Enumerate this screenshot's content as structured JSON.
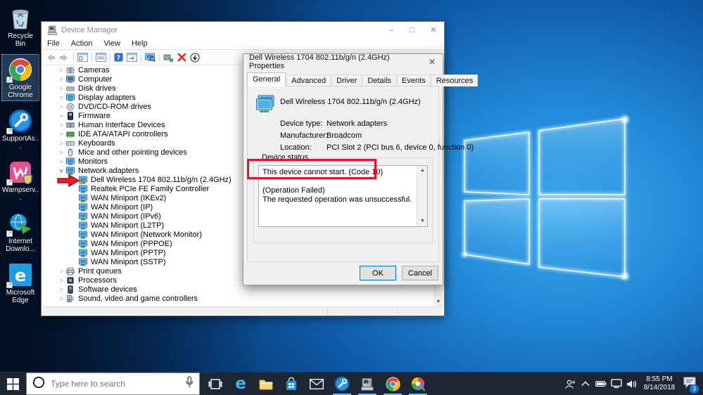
{
  "desktop": {
    "icons": [
      {
        "icon": "recycle-bin",
        "label": "Recycle Bin",
        "selected": false,
        "shortcut": false
      },
      {
        "icon": "google-chrome",
        "label": "Google Chrome",
        "selected": true,
        "shortcut": true
      },
      {
        "icon": "supportassist",
        "label": "SupportAs...",
        "selected": false,
        "shortcut": true
      },
      {
        "icon": "wampserver",
        "label": "Wampserv...",
        "selected": false,
        "shortcut": true
      },
      {
        "icon": "idm",
        "label": "Internet Downlo...",
        "selected": false,
        "shortcut": true
      },
      {
        "icon": "microsoft-edge",
        "label": "Microsoft Edge",
        "selected": false,
        "shortcut": true
      }
    ]
  },
  "device_manager": {
    "title": "Device Manager",
    "menu": [
      "File",
      "Action",
      "View",
      "Help"
    ],
    "toolbar": [
      "back",
      "forward",
      "sep",
      "console",
      "sep",
      "props",
      "sep",
      "help",
      "console2",
      "sep",
      "scan",
      "sep",
      "update",
      "uninstall",
      "disable"
    ],
    "tree": [
      {
        "label": "Cameras",
        "icon": "camera",
        "chev": "collapsed",
        "level": 0
      },
      {
        "label": "Computer",
        "icon": "computer",
        "chev": "collapsed",
        "level": 0
      },
      {
        "label": "Disk drives",
        "icon": "disk",
        "chev": "collapsed",
        "level": 0
      },
      {
        "label": "Display adapters",
        "icon": "display",
        "chev": "collapsed",
        "level": 0
      },
      {
        "label": "DVD/CD-ROM drives",
        "icon": "dvd",
        "chev": "collapsed",
        "level": 0
      },
      {
        "label": "Firmware",
        "icon": "firmware",
        "chev": "collapsed",
        "level": 0
      },
      {
        "label": "Human Interface Devices",
        "icon": "hid",
        "chev": "collapsed",
        "level": 0
      },
      {
        "label": "IDE ATA/ATAPI controllers",
        "icon": "ide",
        "chev": "collapsed",
        "level": 0
      },
      {
        "label": "Keyboards",
        "icon": "keyboard",
        "chev": "collapsed",
        "level": 0
      },
      {
        "label": "Mice and other pointing devices",
        "icon": "mouse",
        "chev": "collapsed",
        "level": 0
      },
      {
        "label": "Monitors",
        "icon": "monitor",
        "chev": "collapsed",
        "level": 0
      },
      {
        "label": "Network adapters",
        "icon": "network",
        "chev": "expanded",
        "level": 0
      },
      {
        "label": "Dell Wireless 1704 802.11b/g/n (2.4GHz)",
        "icon": "warning",
        "chev": "none",
        "level": 1
      },
      {
        "label": "Realtek PCIe FE Family Controller",
        "icon": "netchild",
        "chev": "none",
        "level": 1
      },
      {
        "label": "WAN Miniport (IKEv2)",
        "icon": "netchild",
        "chev": "none",
        "level": 1
      },
      {
        "label": "WAN Miniport (IP)",
        "icon": "netchild",
        "chev": "none",
        "level": 1
      },
      {
        "label": "WAN Miniport (IPv6)",
        "icon": "netchild",
        "chev": "none",
        "level": 1
      },
      {
        "label": "WAN Miniport (L2TP)",
        "icon": "netchild",
        "chev": "none",
        "level": 1
      },
      {
        "label": "WAN Miniport (Network Monitor)",
        "icon": "netchild",
        "chev": "none",
        "level": 1
      },
      {
        "label": "WAN Miniport (PPPOE)",
        "icon": "netchild",
        "chev": "none",
        "level": 1
      },
      {
        "label": "WAN Miniport (PPTP)",
        "icon": "netchild",
        "chev": "none",
        "level": 1
      },
      {
        "label": "WAN Miniport (SSTP)",
        "icon": "netchild",
        "chev": "none",
        "level": 1
      },
      {
        "label": "Print queues",
        "icon": "printer",
        "chev": "collapsed",
        "level": 0
      },
      {
        "label": "Processors",
        "icon": "processor",
        "chev": "collapsed",
        "level": 0
      },
      {
        "label": "Software devices",
        "icon": "software",
        "chev": "collapsed",
        "level": 0
      },
      {
        "label": "Sound, video and game controllers",
        "icon": "sound",
        "chev": "collapsed",
        "level": 0
      }
    ]
  },
  "dialog": {
    "title": "Dell Wireless 1704 802.11b/g/n (2.4GHz) Properties",
    "tabs": [
      "General",
      "Advanced",
      "Driver",
      "Details",
      "Events",
      "Resources"
    ],
    "active_tab": "General",
    "device_name": "Dell Wireless 1704 802.11b/g/n (2.4GHz)",
    "fields": [
      {
        "label": "Device type:",
        "value": "Network adapters"
      },
      {
        "label": "Manufacturer:",
        "value": "Broadcom"
      },
      {
        "label": "Location:",
        "value": "PCI Slot 2 (PCI bus 6, device 0, function 0)"
      }
    ],
    "group_label": "Device status",
    "status_line1": "This device cannot start. (Code 10)",
    "status_line2": "(Operation Failed)",
    "status_line3": "The requested operation was unsuccessful.",
    "ok_label": "OK",
    "cancel_label": "Cancel"
  },
  "taskbar": {
    "search_placeholder": "Type here to search",
    "apps": [
      {
        "icon": "taskview",
        "running": false
      },
      {
        "icon": "edge",
        "running": false
      },
      {
        "icon": "explorer",
        "running": false
      },
      {
        "icon": "store",
        "running": false
      },
      {
        "icon": "mail",
        "running": false
      },
      {
        "icon": "support",
        "running": true
      },
      {
        "icon": "devmgr",
        "running": true
      },
      {
        "icon": "chrome",
        "running": true
      },
      {
        "icon": "paint",
        "running": true
      }
    ],
    "tray": [
      "people",
      "chevron-up",
      "battery",
      "network",
      "volume"
    ],
    "clock_time": "8:55 PM",
    "clock_date": "8/14/2018",
    "notification_count": "3"
  },
  "colors": {
    "annotation_red": "#e8112d",
    "accent": "#0078d7",
    "warning_yellow": "#ffd22e"
  }
}
